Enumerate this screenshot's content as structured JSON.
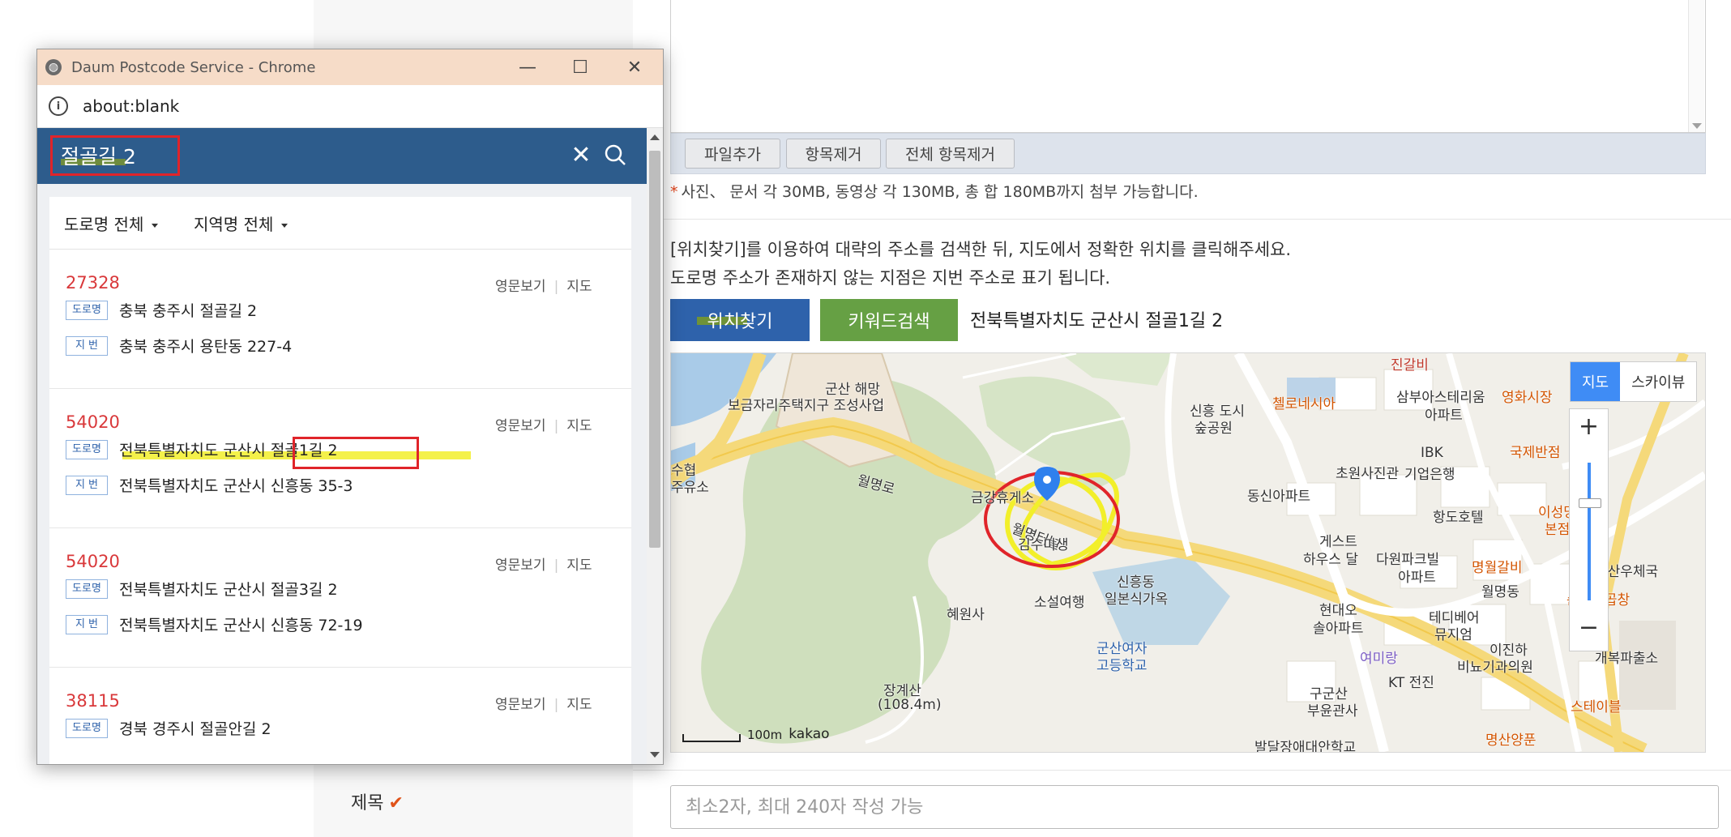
{
  "page": {
    "file_buttons": [
      "파일추가",
      "항목제거",
      "전체 항목제거"
    ],
    "file_note": "사진、 문서 각 30MB, 동영상 각 130MB, 총 합 180MB까지 첨부 가능합니다.",
    "location_desc_1": "[위치찾기]를 이용하여 대략의 주소를 검색한 뒤, 지도에서 정확한 위치를 클릭해주세요.",
    "location_desc_2": "도로명 주소가 존재하지 않는 지점은 지번 주소로 표기 됩니다.",
    "locate_button": "위치찾기",
    "keyword_button": "키워드검색",
    "selected_address": "전북특별자치도 군산시 절골1길 2",
    "map": {
      "type_map": "지도",
      "type_skyview": "스카이뷰",
      "zoom_in": "+",
      "zoom_out": "−",
      "scale": "100m",
      "brand": "kakao",
      "labels": {
        "l1": "진갈비",
        "l2": "군산 해망",
        "l3": "보금자리주택지구 조성사업",
        "l4": "신흥 도시",
        "l5": "숲공원",
        "l6": "첼로네시아",
        "l7": "삼부아스테리움",
        "l8": "아파트",
        "l9": "영화시장",
        "l10": "IBK",
        "l11": "기업은행",
        "l12": "국제반점",
        "l13": "초원사진관",
        "l14": "수협",
        "l15": "주유소",
        "l16": "월명로",
        "l17": "금강휴게소",
        "l18": "동신아파트",
        "l19": "항도호텔",
        "l20": "이성당",
        "l21": "본점",
        "l22": "월명터널",
        "l23": "김수미생",
        "l24": "게스트",
        "l25": "하우스 달",
        "l26": "다원파크빌",
        "l27": "아파트",
        "l28": "명월갈비",
        "l29": "월명동",
        "l30": "군산우체국",
        "l31": "소설여행",
        "l32": "신흥동",
        "l33": "일본식가옥",
        "l34": "혜원사",
        "l35": "현대오",
        "l36": "솔아파트",
        "l37": "테디베어",
        "l38": "뮤지엄",
        "l39": "순돌이곱창",
        "l40": "군산여자",
        "l41": "고등학교",
        "l42": "이진하",
        "l43": "비뇨기과의원",
        "l44": "여미랑",
        "l45": "개복파출소",
        "l46": "장계산",
        "l47": "(108.4m)",
        "l48": "구군산",
        "l49": "부윤관사",
        "l50": "KT 전진",
        "l51": "스테이블",
        "l52": "명산양푼",
        "l53": "발달장애대안학교"
      }
    },
    "title_label": "제목",
    "title_check": "✔",
    "title_placeholder": "최소2자, 최대 240자 작성 가능"
  },
  "popup": {
    "window_title": "Daum Postcode Service - Chrome",
    "controls": {
      "minimize": "—",
      "maximize": "☐",
      "close": "✕"
    },
    "url": "about:blank",
    "search_query": "절골길 2",
    "filters": [
      "도로명 전체",
      "지역명 전체"
    ],
    "results": [
      {
        "zip": "27328",
        "road_tag": "도로명",
        "road": "충북 충주시 절골길 2",
        "jibun_tag": "지 번",
        "jibun": "충북 충주시 용탄동 227-4",
        "eng": "영문보기",
        "map": "지도"
      },
      {
        "zip": "54020",
        "road_tag": "도로명",
        "road": "전북특별자치도 군산시 절골1길 2",
        "jibun_tag": "지 번",
        "jibun": "전북특별자치도 군산시 신흥동 35-3",
        "eng": "영문보기",
        "map": "지도"
      },
      {
        "zip": "54020",
        "road_tag": "도로명",
        "road": "전북특별자치도 군산시 절골3길 2",
        "jibun_tag": "지 번",
        "jibun": "전북특별자치도 군산시 신흥동 72-19",
        "eng": "영문보기",
        "map": "지도"
      },
      {
        "zip": "38115",
        "road_tag": "도로명",
        "road": "경북 경주시 절골안길 2",
        "jibun_tag": "",
        "jibun": "",
        "eng": "영문보기",
        "map": "지도"
      }
    ]
  },
  "colors": {
    "search_bar": "#2d5c8c",
    "locate_button": "#2e62ab",
    "keyword_button": "#66a044",
    "zip_red": "#d9383a",
    "annotation_red": "#e0242a",
    "annotation_yellow": "#f2ef2a"
  }
}
